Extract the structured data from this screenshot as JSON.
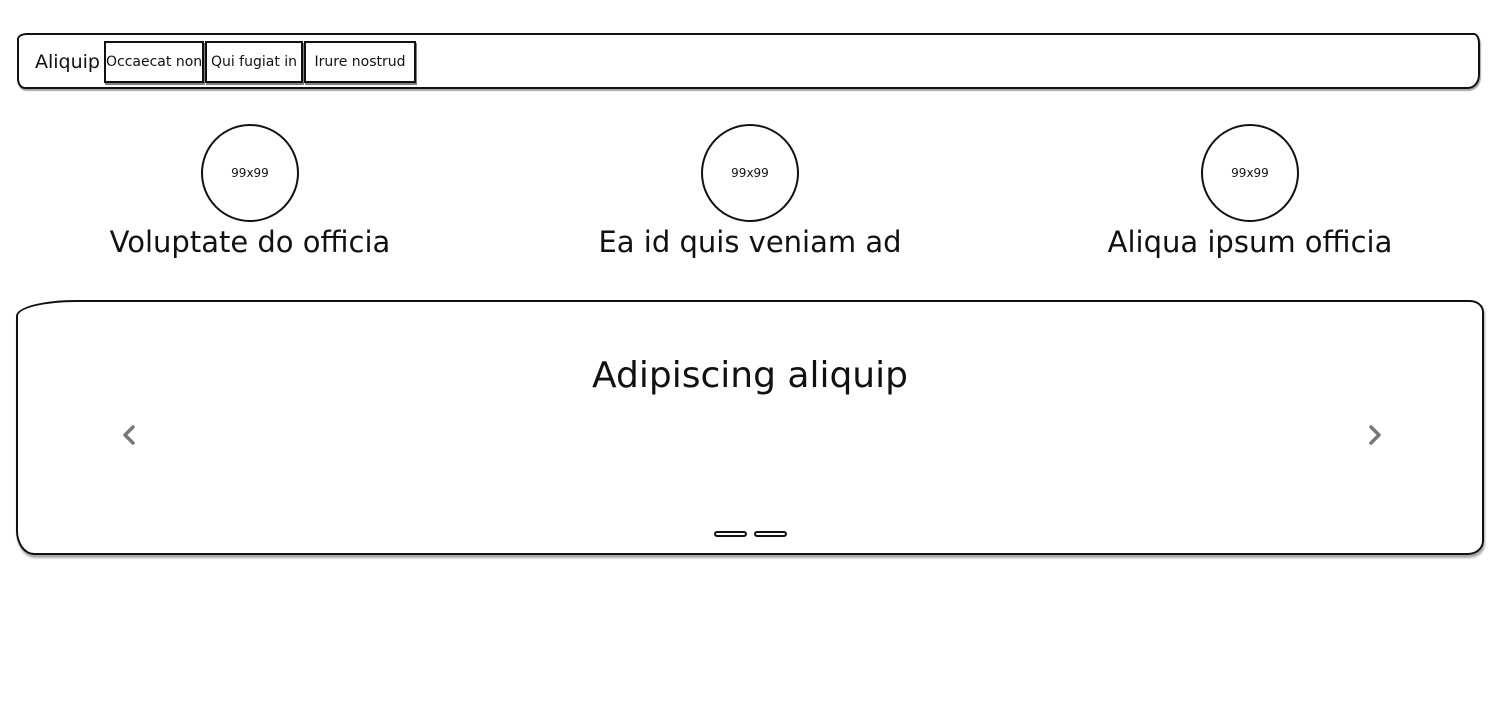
{
  "navbar": {
    "brand": "Aliquip",
    "buttons": [
      {
        "label": "Occaecat non"
      },
      {
        "label": "Qui fugiat in"
      },
      {
        "label": "Irure nostrud"
      }
    ]
  },
  "features": [
    {
      "image_label": "99x99",
      "title": "Voluptate do officia"
    },
    {
      "image_label": "99x99",
      "title": "Ea id quis veniam ad"
    },
    {
      "image_label": "99x99",
      "title": "Aliqua ipsum officia"
    }
  ],
  "carousel": {
    "heading": "Adipiscing aliquip",
    "prev_icon": "chevron-left-icon",
    "next_icon": "chevron-right-icon",
    "slide_count": 2,
    "active_slide": 1
  },
  "colors": {
    "stroke": "#111111",
    "arrow": "#777777",
    "background": "#ffffff"
  }
}
